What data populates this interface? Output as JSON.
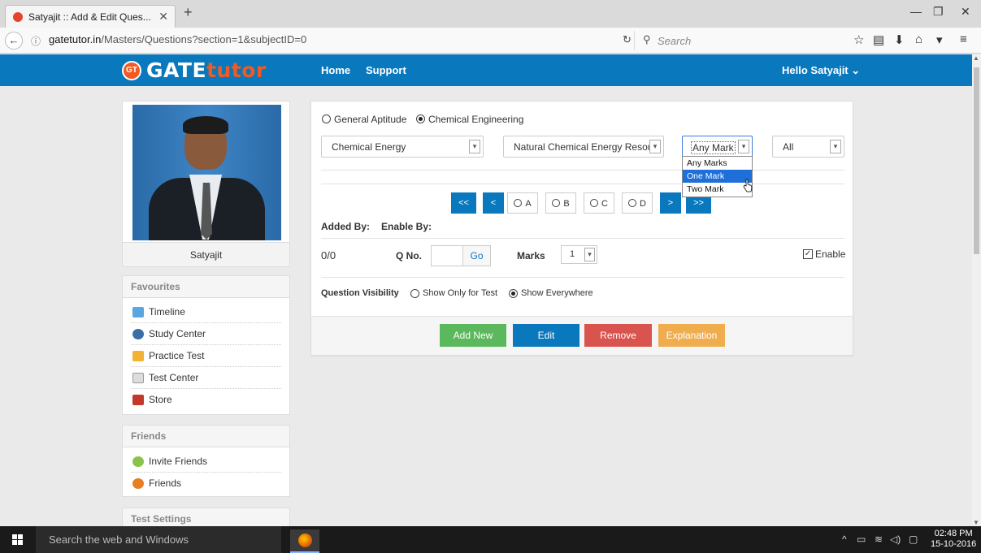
{
  "browser": {
    "tab_title": "Satyajit :: Add & Edit Ques...",
    "url_host": "gatetutor.in",
    "url_path": "/Masters/Questions?section=1&subjectID=0",
    "search_placeholder": "Search"
  },
  "site": {
    "logo_badge": "GT",
    "logo_gate": "GATE",
    "logo_tutor": "tutor",
    "nav": [
      "Home",
      "Support"
    ],
    "user_greeting": "Hello Satyajit ⌄"
  },
  "profile": {
    "name": "Satyajit"
  },
  "favourites": {
    "title": "Favourites",
    "items": [
      "Timeline",
      "Study Center",
      "Practice Test",
      "Test Center",
      "Store"
    ]
  },
  "friends": {
    "title": "Friends",
    "items": [
      "Invite Friends",
      "Friends"
    ]
  },
  "test_settings": {
    "title": "Test Settings"
  },
  "main": {
    "section_options": [
      "General Aptitude",
      "Chemical Engineering"
    ],
    "selected_section": "Chemical Engineering",
    "subject_select": "Chemical Energy",
    "topic_select": "Natural Chemical Energy Resou",
    "marks_filter": "Any Mark",
    "marks_filter_options": [
      "Any Marks",
      "One Mark",
      "Two Mark"
    ],
    "marks_filter_highlighted": "One Mark",
    "all_select": "All",
    "pager": {
      "first": "<<",
      "prev": "<",
      "next": ">",
      "last": ">>",
      "options": [
        "A",
        "B",
        "C",
        "D"
      ]
    },
    "added_by_label": "Added By:",
    "enable_by_label": "Enable By:",
    "count": "0/0",
    "qno_label": "Q No.",
    "go_label": "Go",
    "marks_label": "Marks",
    "marks_value": "1",
    "enable_label": "Enable",
    "enable_checked": true,
    "visibility_label": "Question Visibility",
    "visibility_options": [
      "Show Only for Test",
      "Show Everywhere"
    ],
    "visibility_selected": "Show Everywhere",
    "actions": [
      {
        "label": "Add New",
        "color": "#5cb85c"
      },
      {
        "label": "Edit",
        "color": "#0a78bd"
      },
      {
        "label": "Remove",
        "color": "#d9534f"
      },
      {
        "label": "Explanation",
        "color": "#f0ad4e"
      }
    ]
  },
  "taskbar": {
    "search_placeholder": "Search the web and Windows",
    "time": "02:48 PM",
    "date": "15-10-2016"
  },
  "colors": {
    "brand_blue": "#0a78bd",
    "brand_orange": "#f15a22"
  }
}
